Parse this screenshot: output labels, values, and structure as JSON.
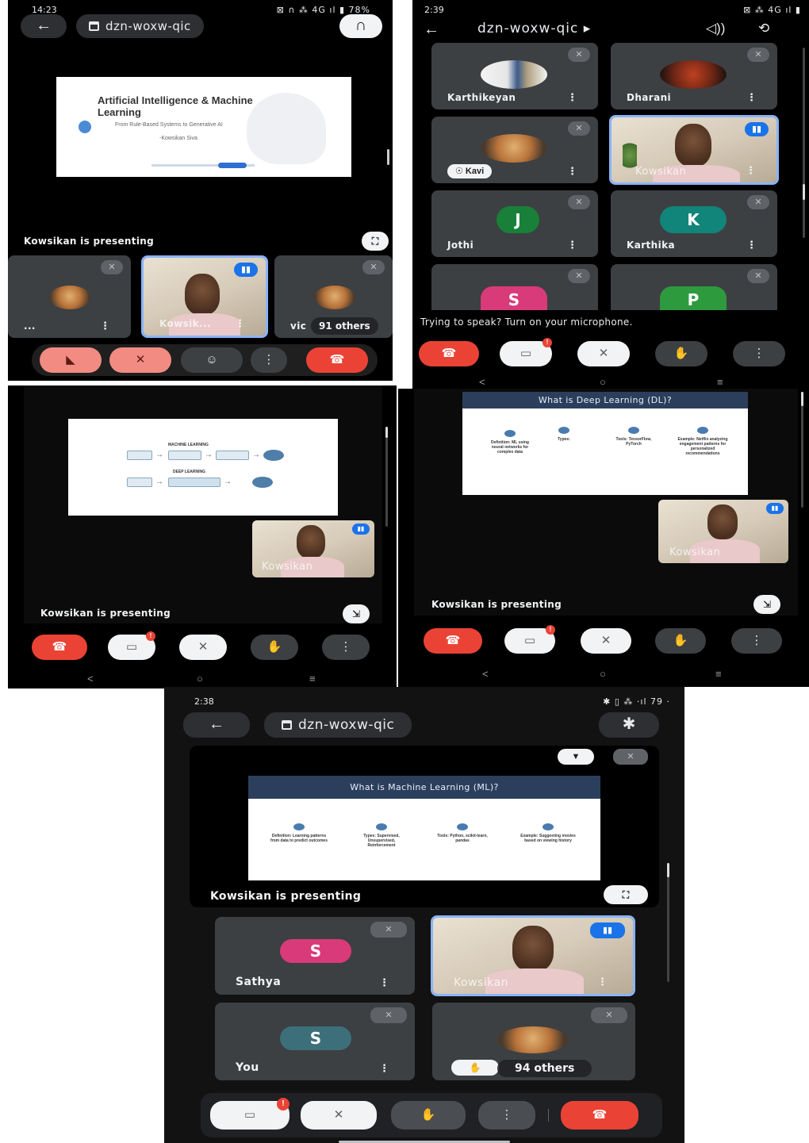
{
  "meeting_code": "dzn-woxw-qic",
  "panel1": {
    "time": "14:23",
    "status_icons": "⊠ ∩ ⁂ 4G ıl ▮ 78%",
    "slide": {
      "title": "Artificial Intelligence & Machine Learning",
      "subtitle": "From Rule-Based Systems to Generative AI",
      "author": "-Kowsikan Siva"
    },
    "presenting": "Kowsikan is presenting",
    "tiles": [
      {
        "name": "..."
      },
      {
        "name": "Kowsik..."
      },
      {
        "name": "vic"
      }
    ],
    "others": "91 others"
  },
  "panel2": {
    "time": "2:39",
    "status_icons": "⊠ ⁂ 4G ıl ▮",
    "participants": [
      {
        "name": "Karthikeyan",
        "type": "photo"
      },
      {
        "name": "Dharani",
        "type": "photo"
      },
      {
        "name": "Kavi",
        "type": "photo"
      },
      {
        "name": "Kowsikan",
        "type": "video"
      },
      {
        "name": "Jothi",
        "type": "letter",
        "letter": "J",
        "color": "#188038"
      },
      {
        "name": "Karthika",
        "type": "letter",
        "letter": "K",
        "color": "#12857a"
      },
      {
        "name": "",
        "type": "letter",
        "letter": "S",
        "color": "#d93a7a"
      },
      {
        "name": "",
        "type": "letter",
        "letter": "P",
        "color": "#2e9a3e"
      }
    ],
    "hint": "Trying to speak? Turn on your microphone."
  },
  "panel3": {
    "slide": {
      "row1_title": "MACHINE LEARNING",
      "row2_title": "DEEP LEARNING"
    },
    "video_label": "Kowsikan",
    "presenting": "Kowsikan is presenting"
  },
  "panel4": {
    "slide": {
      "title": "What is Deep Learning (DL)?",
      "columns": [
        "Definition: ML using neural networks for complex data",
        "Types:",
        "Tools: TensorFlow, PyTorch",
        "Example: Netflix analyzing engagement patterns for personalized recommendations"
      ]
    },
    "video_label": "Kowsikan",
    "presenting": "Kowsikan is presenting"
  },
  "panel5": {
    "time": "2:38",
    "status_icons": "✱ ▯ ⁂ ·ıl 79 ·",
    "slide": {
      "title": "What is Machine Learning (ML)?",
      "columns": [
        "Definition: Learning patterns from data to predict outcomes",
        "Types: Supervised, Unsupervised, Reinforcement",
        "Tools: Python, scikit-learn, pandas",
        "Example: Suggesting movies based on viewing history"
      ]
    },
    "presenting": "Kowsikan is presenting",
    "tiles": [
      {
        "name": "Sathya",
        "letter": "S",
        "color": "#d93a7a"
      },
      {
        "name": "Kowsikan"
      },
      {
        "name": "You",
        "letter": "S",
        "color": "#3d6f7a"
      },
      {
        "name": ""
      }
    ],
    "others": "94 others"
  }
}
